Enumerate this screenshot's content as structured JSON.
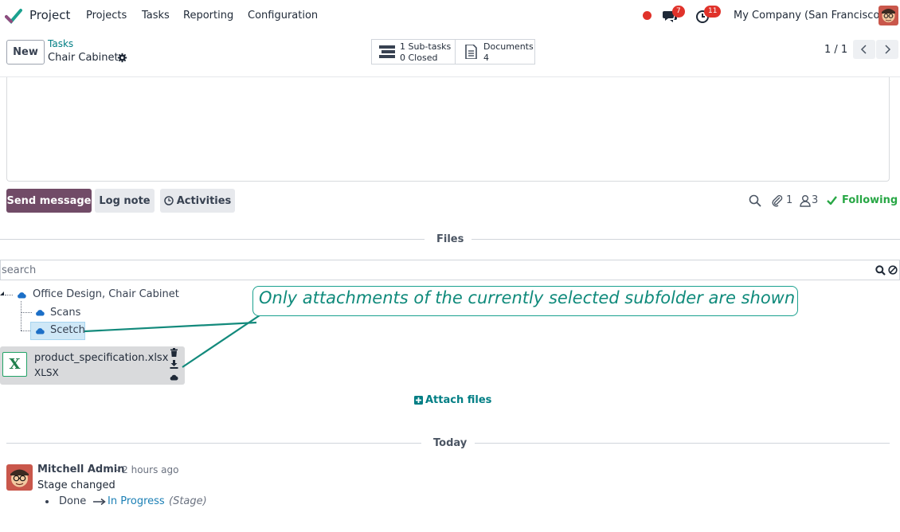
{
  "navbar": {
    "app_name": "Project",
    "menu": [
      "Projects",
      "Tasks",
      "Reporting",
      "Configuration"
    ],
    "messages_count": "7",
    "activities_count": "11",
    "company": "My Company (San Francisco)"
  },
  "control_panel": {
    "new_label": "New",
    "breadcrumb_parent": "Tasks",
    "breadcrumb_current": "Chair Cabinet",
    "smart_buttons": [
      {
        "line1": "1 Sub-tasks",
        "line2": "0 Closed",
        "icon": "tasks-icon"
      },
      {
        "line1": "Documents",
        "line2": "4",
        "icon": "document-icon"
      }
    ],
    "pager": "1 / 1"
  },
  "chatter": {
    "send_message": "Send message",
    "log_note": "Log note",
    "activities": "Activities",
    "attachments_count": "1",
    "followers_count": "3",
    "following": "Following"
  },
  "files": {
    "section_label": "Files",
    "search_placeholder": "search",
    "tree": {
      "root": "Office Design, Chair Cabinet",
      "children": [
        "Scans",
        "Scetch"
      ],
      "selected": "Scetch"
    },
    "attachments": [
      {
        "name": "product_specification.xlsx",
        "type": "XLSX"
      }
    ],
    "attach_files": "Attach files",
    "callout": "Only attachments of the currently selected subfolder are shown"
  },
  "messages": {
    "day_label": "Today",
    "items": [
      {
        "author": "Mitchell Admin",
        "date": "- 2 hours ago",
        "body": "Stage changed",
        "old_value": "Done",
        "new_value": "In Progress",
        "field": "(Stage)"
      }
    ]
  },
  "colors": {
    "primary": "#714b67",
    "link": "#017e84",
    "following": "#28a745",
    "badge": "#e0322a",
    "callout": "#1aa18f"
  }
}
